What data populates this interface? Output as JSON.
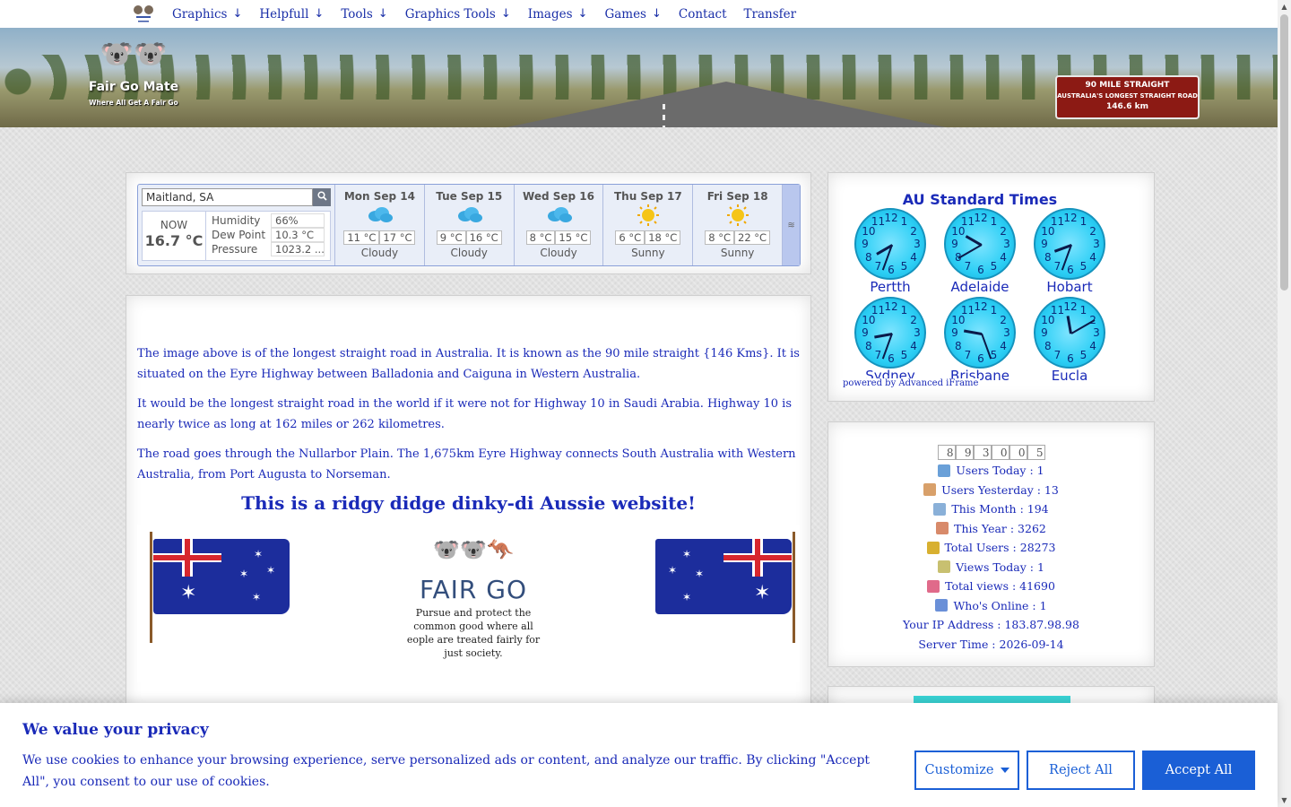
{
  "nav": {
    "items": [
      {
        "label": "Graphics",
        "arrow": "↓"
      },
      {
        "label": "Helpfull",
        "arrow": "↓"
      },
      {
        "label": "Tools",
        "arrow": "↓"
      },
      {
        "label": "Graphics Tools",
        "arrow": "↓"
      },
      {
        "label": "Images",
        "arrow": "↓"
      },
      {
        "label": "Games",
        "arrow": "↓"
      },
      {
        "label": "Contact",
        "arrow": ""
      },
      {
        "label": "Transfer",
        "arrow": ""
      }
    ]
  },
  "banner": {
    "brand_name": "Fair Go Mate",
    "brand_tag": "Where All Get A Fair Go",
    "sign_line1": "90 MILE STRAIGHT",
    "sign_line2": "AUSTRALIA'S LONGEST STRAIGHT ROAD",
    "sign_line3": "146.6 km"
  },
  "weather": {
    "location": "Maitland, SA",
    "now_label": "NOW",
    "now_temp": "16.7 °C",
    "humidity_label": "Humidity",
    "humidity": "66%",
    "dew_label": "Dew Point",
    "dew": "10.3 °C",
    "pressure_label": "Pressure",
    "pressure": "1023.2 ...",
    "days": [
      {
        "name": "Mon Sep 14",
        "low": "11 °C",
        "high": "17 °C",
        "cond": "Cloudy",
        "icon": "cloud-icon"
      },
      {
        "name": "Tue Sep 15",
        "low": "9 °C",
        "high": "16 °C",
        "cond": "Cloudy",
        "icon": "cloud-icon"
      },
      {
        "name": "Wed Sep 16",
        "low": "8 °C",
        "high": "15 °C",
        "cond": "Cloudy",
        "icon": "cloud-icon"
      },
      {
        "name": "Thu Sep 17",
        "low": "6 °C",
        "high": "18 °C",
        "cond": "Sunny",
        "icon": "sun-icon"
      },
      {
        "name": "Fri Sep 18",
        "low": "8 °C",
        "high": "22 °C",
        "cond": "Sunny",
        "icon": "sun-icon"
      }
    ]
  },
  "content": {
    "p1": "The image above is of the longest straight road in Australia. It is known as the 90 mile straight {146 Kms}. It is situated on the Eyre Highway between Balladonia and Caiguna in Western Australia.",
    "p2": "It would be the longest straight road in the world if it were not for Highway 10 in Saudi Arabia. Highway 10 is nearly twice as long at 162 miles or 262 kilometres.",
    "p3": "The road goes through the Nullarbor Plain. The 1,675km Eyre Highway connects South Australia with Western Australia, from Port Augusta to Norseman.",
    "headline": "This is a ridgy didge dinky-di Aussie website!",
    "fairgo_title": "FAIR GO",
    "fairgo_text": "Pursue and protect the common good where all eople are treated fairly for just society."
  },
  "clocks": {
    "title": "AU Standard Times",
    "cities": [
      "Pertth",
      "Adelaide",
      "Hobart",
      "Sydney",
      "Brisbane",
      "Eucla"
    ],
    "powered": "powered by Advanced iFrame"
  },
  "stats": {
    "digits": [
      "8",
      "9",
      "3",
      "0",
      "0",
      "5"
    ],
    "rows": [
      {
        "text": "Users Today : 1",
        "icon": "user-icon",
        "color": "#6aa0d8"
      },
      {
        "text": "Users Yesterday : 13",
        "icon": "user-icon",
        "color": "#d8a06a"
      },
      {
        "text": "This Month : 194",
        "icon": "calendar-icon",
        "color": "#8ab0d8"
      },
      {
        "text": "This Year : 3262",
        "icon": "calendar-icon",
        "color": "#d88a6a"
      },
      {
        "text": "Total Users : 28273",
        "icon": "bar-chart-icon",
        "color": "#d8b030"
      },
      {
        "text": "Views Today : 1",
        "icon": "calendar-icon",
        "color": "#c8c070"
      },
      {
        "text": "Total views : 41690",
        "icon": "bar-chart-icon",
        "color": "#e06a8a"
      },
      {
        "text": "Who's Online : 1",
        "icon": "user-icon",
        "color": "#6a90d8"
      }
    ],
    "ip": "Your IP Address : 183.87.98.98",
    "server_time": "Server Time : 2026-09-14"
  },
  "cookie": {
    "title": "We value your privacy",
    "text": "We use cookies to enhance your browsing experience, serve personalized ads or content, and analyze our traffic. By clicking \"Accept All\", you consent to our use of cookies.",
    "customize": "Customize",
    "reject": "Reject All",
    "accept": "Accept All"
  }
}
